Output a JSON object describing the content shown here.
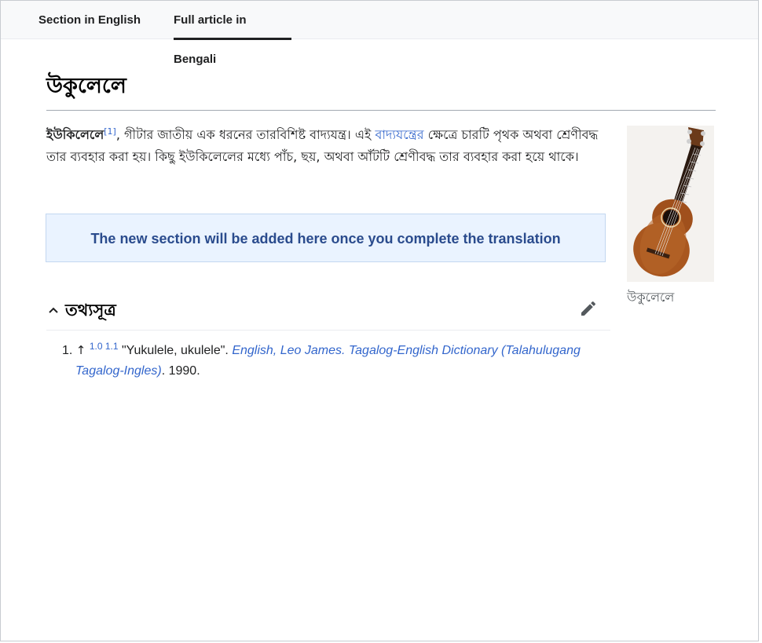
{
  "tabs": [
    {
      "label": "Section in English"
    },
    {
      "label": "Full article in Bengali"
    }
  ],
  "article": {
    "title": "উকুলেলে",
    "lead": {
      "term": "ইউকিলেলে",
      "ref_mark": "[1]",
      "text1": ", গীটার জাতীয় এক ধরনের তারবিশিষ্ট বাদ্যযন্ত্র। এই ",
      "link": "বাদ্যযন্ত্রের",
      "text2": " ক্ষেত্রে চারটি পৃথক অথবা শ্রেণীবদ্ধ তার ব্যবহার করা হয়। কিছু ইউকিলেলের মধ্যে পাঁচ, ছয়, অথবা আঁটটি শ্রেণীবদ্ধ তার ব্যবহার করা হয়ে থাকে।"
    },
    "notice": "The new section will be added here once you complete the translation",
    "figure": {
      "caption": "উকুলেলে"
    },
    "references": {
      "heading": "তথ্যসূত্র",
      "items": [
        {
          "number": "1.",
          "arrow": "↑",
          "backlinks": "1.0 1.1",
          "quote": "\"Yukulele, ukulele\". ",
          "source_line1": "English, Leo James. Tagalog-English Dictionary (Talahulugang",
          "source_line2": "Tagalog-Ingles)",
          "year": ". 1990."
        }
      ]
    }
  },
  "icons": {
    "collapse": "chevron-up-icon",
    "edit": "pencil-icon"
  },
  "colors": {
    "link": "#3366cc",
    "notice_bg": "#eaf3ff",
    "notice_text": "#2a4b8d"
  }
}
